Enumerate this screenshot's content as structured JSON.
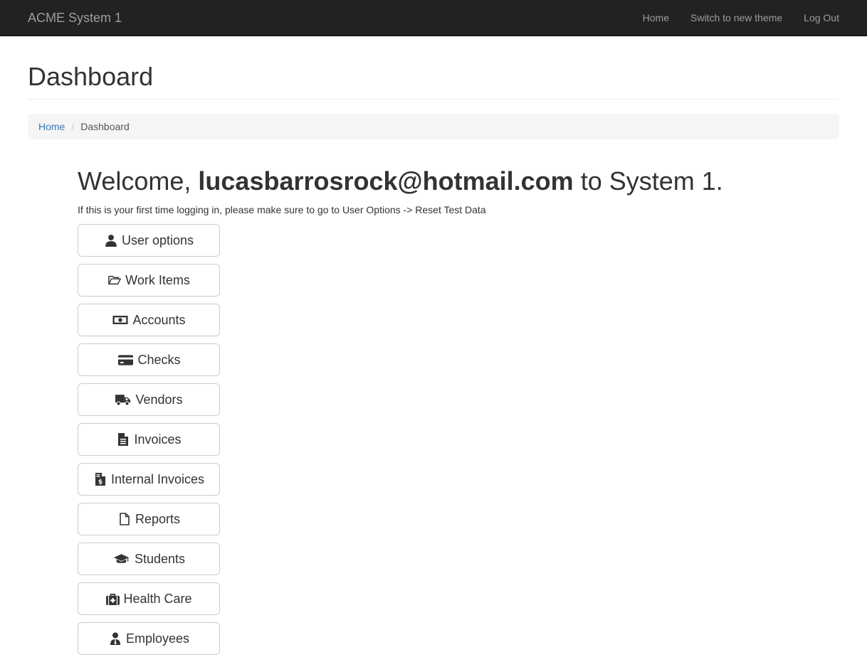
{
  "navbar": {
    "brand": "ACME System 1",
    "links": [
      {
        "label": "Home"
      },
      {
        "label": "Switch to new theme"
      },
      {
        "label": "Log Out"
      }
    ]
  },
  "page": {
    "title": "Dashboard"
  },
  "breadcrumb": {
    "home": "Home",
    "separator": "/",
    "current": "Dashboard"
  },
  "welcome": {
    "prefix": "Welcome,",
    "email": "lucasbarrosrock@hotmail.com",
    "suffix": "to System 1.",
    "hint": "If this is your first time logging in, please make sure to go to User Options -> Reset Test Data"
  },
  "menu": [
    {
      "label": "User options",
      "icon": "user-icon"
    },
    {
      "label": "Work Items",
      "icon": "folder-open-icon"
    },
    {
      "label": "Accounts",
      "icon": "money-bill-icon"
    },
    {
      "label": "Checks",
      "icon": "credit-card-icon"
    },
    {
      "label": "Vendors",
      "icon": "truck-icon"
    },
    {
      "label": "Invoices",
      "icon": "file-text-icon"
    },
    {
      "label": "Internal Invoices",
      "icon": "file-invoice-dollar-icon"
    },
    {
      "label": "Reports",
      "icon": "file-icon"
    },
    {
      "label": "Students",
      "icon": "graduation-cap-icon"
    },
    {
      "label": "Health Care",
      "icon": "medkit-icon"
    },
    {
      "label": "Employees",
      "icon": "user-tie-icon"
    }
  ],
  "colors": {
    "navbar_bg": "#222222",
    "navbar_text": "#9d9d9d",
    "link": "#337ab7",
    "breadcrumb_bg": "#f5f5f5",
    "text": "#333333"
  }
}
